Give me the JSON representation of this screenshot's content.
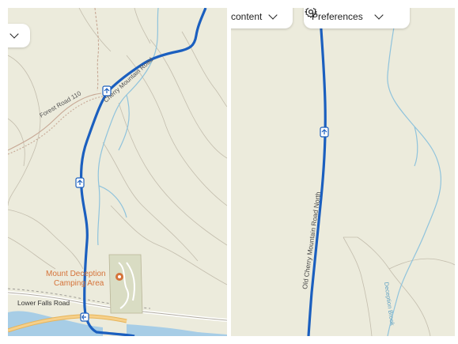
{
  "toolbar": {
    "content_label": "content",
    "preferences_label": "Preferences",
    "gear_icon": "gear-icon",
    "chevron_icon": "chevron-down-icon"
  },
  "left_map": {
    "road_labels": {
      "forest_road": "Forest Road 110",
      "cherry_mountain_road": "Cherry Mountain Road",
      "lower_falls_road": "Lower Falls Road"
    },
    "poi": {
      "name_line1": "Mount Deception",
      "name_line2": "Camping Area",
      "icon": "campground-marker-icon"
    }
  },
  "right_map": {
    "road_labels": {
      "old_cherry_mountain_road": "Old Cherry Mountain Road North"
    },
    "stream_labels": {
      "deception_brook": "Deception Brook"
    }
  },
  "colors": {
    "map_bg": "#ecebdc",
    "route": "#1b5fbf",
    "stream": "#8fc3dc",
    "contour": "#bdb7a7",
    "trail": "#c7a895",
    "highway": "#f2c46b",
    "water": "#a7cde6",
    "poi": "#d5733a",
    "campground_fill": "#d9dcc3"
  }
}
